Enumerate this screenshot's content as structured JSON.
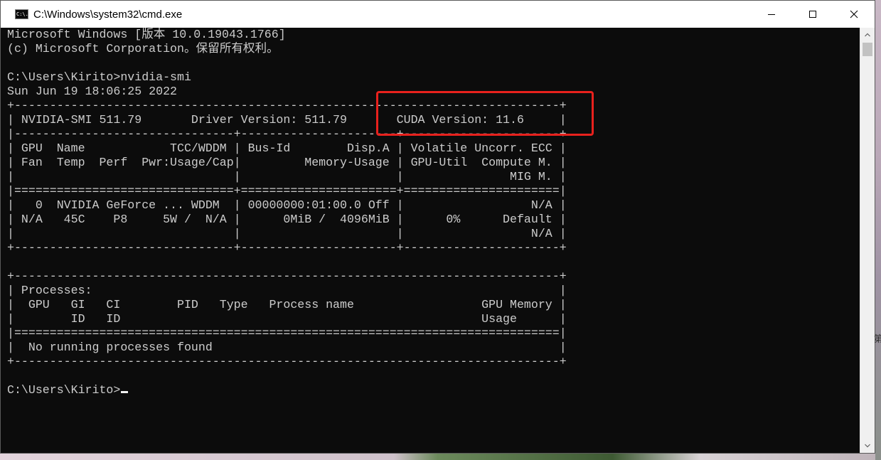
{
  "window": {
    "title": "C:\\Windows\\system32\\cmd.exe",
    "icon": "cmd-console-icon",
    "icon_text": "C:\\."
  },
  "controls": {
    "minimize_icon": "minimize-icon",
    "maximize_icon": "maximize-icon",
    "close_icon": "close-icon"
  },
  "console": {
    "lines": [
      "Microsoft Windows [版本 10.0.19043.1766]",
      "(c) Microsoft Corporation。保留所有权利。",
      "",
      "C:\\Users\\Kirito>nvidia-smi",
      "Sun Jun 19 18:06:25 2022",
      "+-----------------------------------------------------------------------------+",
      "| NVIDIA-SMI 511.79       Driver Version: 511.79       CUDA Version: 11.6     |",
      "|-------------------------------+----------------------+----------------------+",
      "| GPU  Name            TCC/WDDM | Bus-Id        Disp.A | Volatile Uncorr. ECC |",
      "| Fan  Temp  Perf  Pwr:Usage/Cap|         Memory-Usage | GPU-Util  Compute M. |",
      "|                               |                      |               MIG M. |",
      "|===============================+======================+======================|",
      "|   0  NVIDIA GeForce ... WDDM  | 00000000:01:00.0 Off |                  N/A |",
      "| N/A   45C    P8     5W /  N/A |      0MiB /  4096MiB |      0%      Default |",
      "|                               |                      |                  N/A |",
      "+-------------------------------+----------------------+----------------------+",
      "",
      "+-----------------------------------------------------------------------------+",
      "| Processes:                                                                  |",
      "|  GPU   GI   CI        PID   Type   Process name                  GPU Memory |",
      "|        ID   ID                                                   Usage      |",
      "|=============================================================================|",
      "|  No running processes found                                                 |",
      "+-----------------------------------------------------------------------------+",
      ""
    ],
    "prompt": "C:\\Users\\Kirito>"
  },
  "highlight": {
    "color": "#e8211d"
  },
  "colors": {
    "background": "#0c0c0c",
    "text": "#cccccc",
    "titlebar": "#ffffff"
  },
  "desktop": {
    "edge_glyph": "第"
  }
}
